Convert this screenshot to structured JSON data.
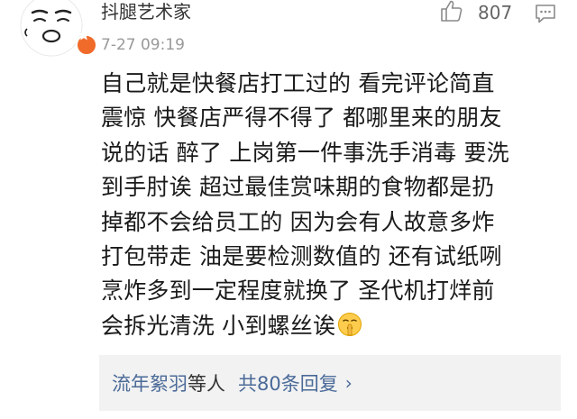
{
  "user": {
    "name": "抖腿艺术家",
    "timestamp": "7-27 09:19"
  },
  "likes": {
    "count": "807"
  },
  "comment": {
    "lines": [
      "自己就是快餐店打工过的 看完评论简直",
      "震惊 快餐店严得不得了 都哪里来的朋友",
      "说的话 醉了 上岗第一件事洗手消毒 要洗",
      "到手肘诶 超过最佳赏味期的食物都是扔",
      "掉都不会给员工的 因为会有人故意多炸",
      "打包带走 油是要检测数值的 还有试纸咧",
      "烹炸多到一定程度就换了 圣代机打烊前",
      "会拆光清洗 小到螺丝诶"
    ]
  },
  "replies": {
    "names": "流年絮羽",
    "etc": "等人",
    "total": "共80条回复",
    "chevron": "›"
  },
  "icons": {
    "avatar": "sleepy-face-avatar",
    "badge": "vip-badge-icon",
    "like": "thumbs-up-icon",
    "reply": "comment-bubble-icon",
    "emoji": "shushing-face-emoji"
  },
  "colors": {
    "link": "#4a6a98",
    "badge": "#f06a29",
    "muted": "#999999",
    "replies_bg": "#f2f2f2"
  }
}
